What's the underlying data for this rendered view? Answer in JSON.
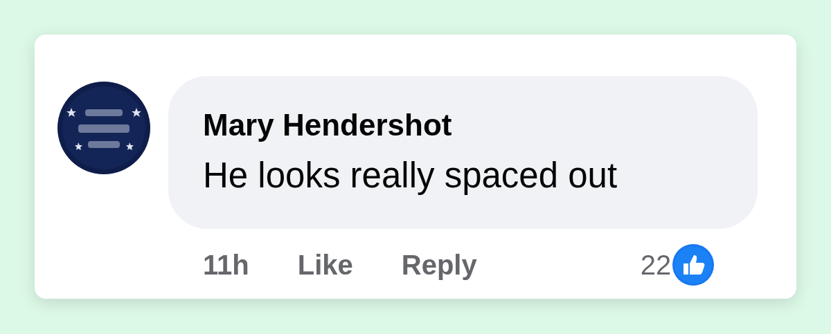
{
  "comment": {
    "author": "Mary Hendershot",
    "text": "He looks really spaced out",
    "time": "11h",
    "like": "Like",
    "reply": "Reply",
    "reaction_count": "22"
  }
}
